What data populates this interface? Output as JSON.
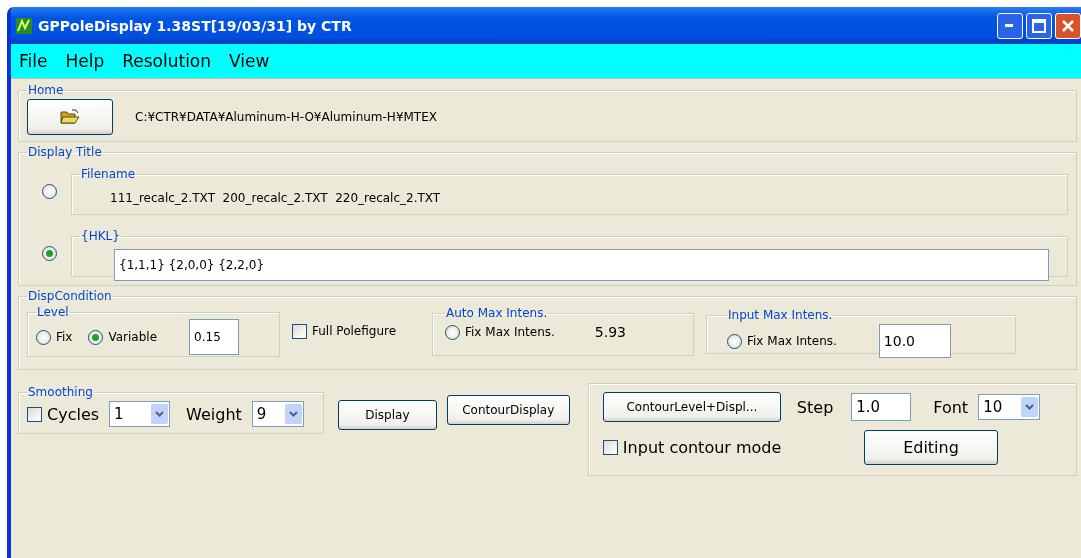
{
  "window": {
    "title": "GPPoleDisplay 1.38ST[19/03/31] by CTR"
  },
  "menu": [
    "File",
    "Help",
    "Resolution",
    "View"
  ],
  "home": {
    "legend": "Home",
    "path": "C:¥CTR¥DATA¥Aluminum-H-O¥Aluminum-H¥MTEX"
  },
  "display_title": {
    "legend": "Display Title",
    "options": [
      {
        "legend": "Filename",
        "kind": "text",
        "value": "111_recalc_2.TXT  200_recalc_2.TXT  220_recalc_2.TXT",
        "selected": false
      },
      {
        "legend": "{HKL}",
        "kind": "field",
        "value": "{1,1,1} {2,0,0} {2,2,0}",
        "selected": true
      }
    ]
  },
  "disp_condition": {
    "legend": "DispCondition",
    "level": {
      "legend": "Level",
      "options": [
        {
          "label": "Fix",
          "selected": false
        },
        {
          "label": "Variable",
          "selected": true
        }
      ],
      "value": "0.15"
    },
    "full_polefigure": {
      "label": "Full Polefigure",
      "checked": false
    },
    "auto_max": {
      "legend": "Auto Max Intens.",
      "option": {
        "label": "Fix Max Intens.",
        "selected": false
      },
      "value": "5.93"
    },
    "input_max": {
      "legend": "Input Max Intens.",
      "option": {
        "label": "Fix Max Intens.",
        "selected": false
      },
      "value": "10.0"
    }
  },
  "smoothing": {
    "legend": "Smoothing",
    "cycles": {
      "label": "Cycles",
      "checked": false
    },
    "cycles_value": "1",
    "weight_label": "Weight",
    "weight_value": "9"
  },
  "buttons": [
    "Display",
    "ContourDisplay"
  ],
  "contour_panel": {
    "button": "ContourLevel+Displ...",
    "step_label": "Step",
    "step_value": "1.0",
    "font_label": "Font",
    "font_value": "10",
    "input_contour_mode": {
      "label": "Input contour mode",
      "checked": false
    },
    "editing": "Editing"
  }
}
